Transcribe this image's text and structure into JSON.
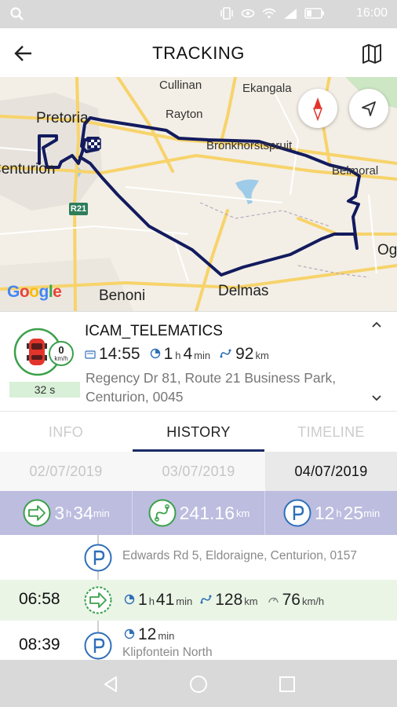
{
  "status_bar": {
    "time": "16:00"
  },
  "header": {
    "title": "TRACKING"
  },
  "map": {
    "labels": {
      "pretoria": "Pretoria",
      "cullinan": "Cullinan",
      "ekangala": "Ekangala",
      "rayton": "Rayton",
      "bronkhorstspruit": "Bronkhorstspruit",
      "belmoral": "Belmoral",
      "centurion": "Centurion",
      "benoni": "Benoni",
      "delmas": "Delmas",
      "ogi": "Ogi"
    },
    "route_badge": "R21",
    "google": "Google",
    "route_color": "#131b5e"
  },
  "vehicle": {
    "name": "ICAM_TELEMATICS",
    "speed": "0",
    "speed_unit": "km/h",
    "duration": "32 s",
    "time": "14:55",
    "driving_h": "1",
    "driving_h_unit": "h",
    "driving_min": "4",
    "driving_min_unit": "min",
    "distance": "92",
    "distance_unit": "km",
    "address": "Regency Dr 81, Route 21 Business Park, Centurion, 0045"
  },
  "tabs": [
    {
      "label": "INFO",
      "active": false
    },
    {
      "label": "HISTORY",
      "active": true
    },
    {
      "label": "TIMELINE",
      "active": false
    }
  ],
  "dates": [
    {
      "label": "02/07/2019",
      "active": false
    },
    {
      "label": "03/07/2019",
      "active": false
    },
    {
      "label": "04/07/2019",
      "active": true
    }
  ],
  "summary": {
    "drive_h": "3",
    "drive_h_unit": "h",
    "drive_min": "34",
    "drive_min_unit": "min",
    "distance": "241.16",
    "distance_unit": "km",
    "park_h": "12",
    "park_h_unit": "h",
    "park_min": "25",
    "park_min_unit": "min"
  },
  "timeline": [
    {
      "type": "parking",
      "address": "Edwards Rd 5, Eldoraigne, Centurion, 0157"
    },
    {
      "type": "drive",
      "time": "06:58",
      "hours": "1",
      "h_unit": "h",
      "minutes": "41",
      "min_unit": "min",
      "distance": "128",
      "distance_unit": "km",
      "speed": "76",
      "speed_unit": "km/h"
    },
    {
      "type": "parking",
      "time": "08:39",
      "minutes": "12",
      "min_unit": "min",
      "address": "Klipfontein North"
    }
  ],
  "colors": {
    "accent_green": "#3aa04a",
    "accent_blue": "#2e6fb8",
    "summary_bg": "#bcbddf",
    "tab_underline": "#1a2b66",
    "drive_row_bg": "#eaf5e6"
  }
}
